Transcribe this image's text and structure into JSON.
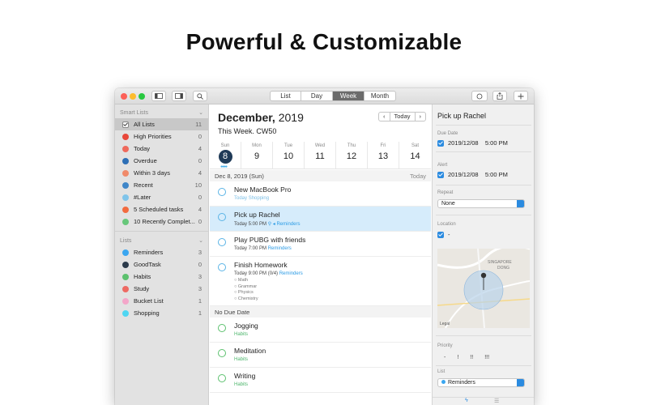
{
  "headline": "Powerful & Customizable",
  "toolbar": {
    "views": [
      "List",
      "Day",
      "Week",
      "Month"
    ],
    "active_view": "Week"
  },
  "sidebar": {
    "smart_header": "Smart Lists",
    "smart": [
      {
        "label": "All Lists",
        "count": "11",
        "color": "#ffffff"
      },
      {
        "label": "High Priorities",
        "count": "0",
        "color": "#e8473a"
      },
      {
        "label": "Today",
        "count": "4",
        "color": "#ef6a5c"
      },
      {
        "label": "Overdue",
        "count": "0",
        "color": "#2d6fb6"
      },
      {
        "label": "Within 3 days",
        "count": "4",
        "color": "#f08a6a"
      },
      {
        "label": "Recent",
        "count": "10",
        "color": "#3f86c8"
      },
      {
        "label": "#Later",
        "count": "0",
        "color": "#7fc4ea"
      },
      {
        "label": "5 Scheduled tasks",
        "count": "4",
        "color": "#f26b3f"
      },
      {
        "label": "10 Recently Complet...",
        "count": "0",
        "color": "#67c77a"
      }
    ],
    "lists_header": "Lists",
    "lists": [
      {
        "label": "Reminders",
        "count": "3",
        "color": "#3aa6f0"
      },
      {
        "label": "GoodTask",
        "count": "0",
        "color": "#2b3a4a"
      },
      {
        "label": "Habits",
        "count": "3",
        "color": "#5cc16e"
      },
      {
        "label": "Study",
        "count": "3",
        "color": "#ee6a63"
      },
      {
        "label": "Bucket List",
        "count": "1",
        "color": "#f4a6c9"
      },
      {
        "label": "Shopping",
        "count": "1",
        "color": "#4fd6f2"
      }
    ]
  },
  "main": {
    "month": "December,",
    "year": "2019",
    "week_line": "This Week. CW50",
    "today_btn": "Today",
    "days": [
      {
        "name": "Sun",
        "num": "8",
        "today": true
      },
      {
        "name": "Mon",
        "num": "9"
      },
      {
        "name": "Tue",
        "num": "10"
      },
      {
        "name": "Wed",
        "num": "11"
      },
      {
        "name": "Thu",
        "num": "12"
      },
      {
        "name": "Fri",
        "num": "13"
      },
      {
        "name": "Sat",
        "num": "14"
      }
    ],
    "section1": {
      "left": "Dec 8, 2019 (Sun)",
      "right": "Today"
    },
    "tasks": [
      {
        "title": "New MacBook Pro",
        "sub_a": "Today",
        "sub_b": "Shopping"
      },
      {
        "title": "Pick up Rachel",
        "sub_a": "Today 5:00 PM",
        "sub_b": "Reminders"
      },
      {
        "title": "Play PUBG with friends",
        "sub_a": "Today 7:00 PM",
        "sub_b": "Reminders"
      },
      {
        "title": "Finish Homework",
        "sub_a": "Today 9:00 PM (0/4)",
        "sub_b": "Reminders",
        "subitems": [
          "Math",
          "Grammar",
          "Physics",
          "Chemistry"
        ]
      }
    ],
    "section2": {
      "left": "No Due Date"
    },
    "nodue": [
      {
        "title": "Jogging",
        "list": "Habits"
      },
      {
        "title": "Meditation",
        "list": "Habits"
      },
      {
        "title": "Writing",
        "list": "Habits"
      }
    ]
  },
  "detail": {
    "title": "Pick up Rachel",
    "due_label": "Due Date",
    "due_date": "2019/12/08",
    "due_time": "5:00 PM",
    "alert_label": "Alert",
    "alert_date": "2019/12/08",
    "alert_time": "5:00 PM",
    "repeat_label": "Repeat",
    "repeat_value": "None",
    "location_label": "Location",
    "location_value": "-",
    "map_text_1": "SINGAPORE",
    "map_text_2": "DONG",
    "map_legal": "Legal",
    "priority_label": "Priority",
    "priorities": [
      "-",
      "!",
      "!!",
      "!!!"
    ],
    "list_label": "List",
    "list_value": "Reminders"
  }
}
